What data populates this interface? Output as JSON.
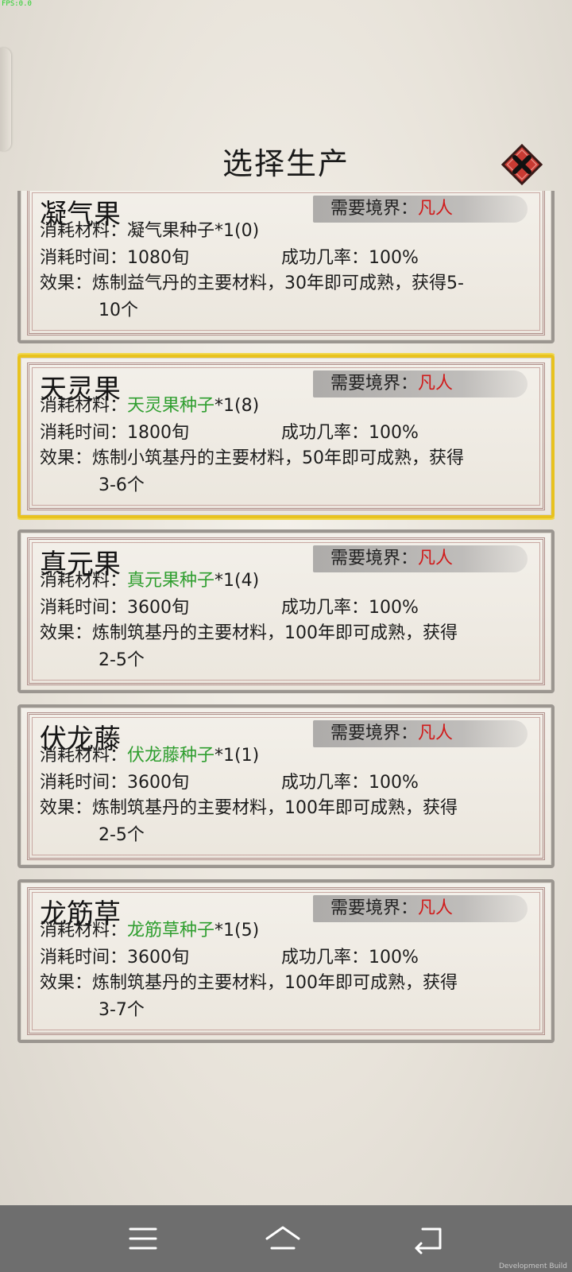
{
  "fps_label": "FPS:0.0",
  "dialog": {
    "title": "选择生产",
    "close_icon": "close-x-icon"
  },
  "realm_label": "需要境界：",
  "material_label": "消耗材料：",
  "time_label": "消耗时间：",
  "rate_label": "成功几率：",
  "effect_label": "效果：",
  "colors": {
    "accent_green": "#2f9e2f",
    "realm_red": "#d01a1a",
    "selected_border": "#e8c21f"
  },
  "items": [
    {
      "name": "凝气果",
      "realm": "凡人",
      "material": "凝气果种子",
      "material_suffix": "*1(0)",
      "material_available": false,
      "time": "1080旬",
      "rate": "100%",
      "effect_line1": "炼制益气丹的主要材料，30年即可成熟，获得5-",
      "effect_line2": "10个",
      "selected": false
    },
    {
      "name": "天灵果",
      "realm": "凡人",
      "material": "天灵果种子",
      "material_suffix": "*1(8)",
      "material_available": true,
      "time": "1800旬",
      "rate": "100%",
      "effect_line1": "炼制小筑基丹的主要材料，50年即可成熟，获得",
      "effect_line2": "3-6个",
      "selected": true
    },
    {
      "name": "真元果",
      "realm": "凡人",
      "material": "真元果种子",
      "material_suffix": "*1(4)",
      "material_available": true,
      "time": "3600旬",
      "rate": "100%",
      "effect_line1": "炼制筑基丹的主要材料，100年即可成熟，获得",
      "effect_line2": "2-5个",
      "selected": false
    },
    {
      "name": "伏龙藤",
      "realm": "凡人",
      "material": "伏龙藤种子",
      "material_suffix": "*1(1)",
      "material_available": true,
      "time": "3600旬",
      "rate": "100%",
      "effect_line1": "炼制筑基丹的主要材料，100年即可成熟，获得",
      "effect_line2": "2-5个",
      "selected": false
    },
    {
      "name": "龙筋草",
      "realm": "凡人",
      "material": "龙筋草种子",
      "material_suffix": "*1(5)",
      "material_available": true,
      "time": "3600旬",
      "rate": "100%",
      "effect_line1": "炼制筑基丹的主要材料，100年即可成熟，获得",
      "effect_line2": "3-7个",
      "selected": false
    }
  ],
  "navbar": {
    "menu_icon": "menu-icon",
    "home_icon": "home-icon",
    "back_icon": "back-icon"
  },
  "dev_build_label": "Development Build"
}
